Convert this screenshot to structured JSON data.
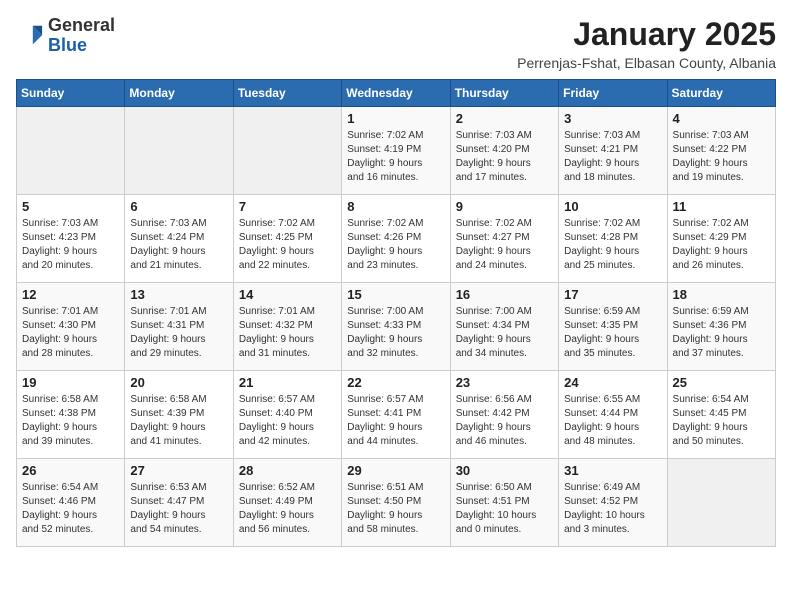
{
  "logo": {
    "general": "General",
    "blue": "Blue"
  },
  "title": {
    "month_year": "January 2025",
    "location": "Perrenjas-Fshat, Elbasan County, Albania"
  },
  "days_of_week": [
    "Sunday",
    "Monday",
    "Tuesday",
    "Wednesday",
    "Thursday",
    "Friday",
    "Saturday"
  ],
  "weeks": [
    [
      {
        "day": "",
        "info": ""
      },
      {
        "day": "",
        "info": ""
      },
      {
        "day": "",
        "info": ""
      },
      {
        "day": "1",
        "info": "Sunrise: 7:02 AM\nSunset: 4:19 PM\nDaylight: 9 hours\nand 16 minutes."
      },
      {
        "day": "2",
        "info": "Sunrise: 7:03 AM\nSunset: 4:20 PM\nDaylight: 9 hours\nand 17 minutes."
      },
      {
        "day": "3",
        "info": "Sunrise: 7:03 AM\nSunset: 4:21 PM\nDaylight: 9 hours\nand 18 minutes."
      },
      {
        "day": "4",
        "info": "Sunrise: 7:03 AM\nSunset: 4:22 PM\nDaylight: 9 hours\nand 19 minutes."
      }
    ],
    [
      {
        "day": "5",
        "info": "Sunrise: 7:03 AM\nSunset: 4:23 PM\nDaylight: 9 hours\nand 20 minutes."
      },
      {
        "day": "6",
        "info": "Sunrise: 7:03 AM\nSunset: 4:24 PM\nDaylight: 9 hours\nand 21 minutes."
      },
      {
        "day": "7",
        "info": "Sunrise: 7:02 AM\nSunset: 4:25 PM\nDaylight: 9 hours\nand 22 minutes."
      },
      {
        "day": "8",
        "info": "Sunrise: 7:02 AM\nSunset: 4:26 PM\nDaylight: 9 hours\nand 23 minutes."
      },
      {
        "day": "9",
        "info": "Sunrise: 7:02 AM\nSunset: 4:27 PM\nDaylight: 9 hours\nand 24 minutes."
      },
      {
        "day": "10",
        "info": "Sunrise: 7:02 AM\nSunset: 4:28 PM\nDaylight: 9 hours\nand 25 minutes."
      },
      {
        "day": "11",
        "info": "Sunrise: 7:02 AM\nSunset: 4:29 PM\nDaylight: 9 hours\nand 26 minutes."
      }
    ],
    [
      {
        "day": "12",
        "info": "Sunrise: 7:01 AM\nSunset: 4:30 PM\nDaylight: 9 hours\nand 28 minutes."
      },
      {
        "day": "13",
        "info": "Sunrise: 7:01 AM\nSunset: 4:31 PM\nDaylight: 9 hours\nand 29 minutes."
      },
      {
        "day": "14",
        "info": "Sunrise: 7:01 AM\nSunset: 4:32 PM\nDaylight: 9 hours\nand 31 minutes."
      },
      {
        "day": "15",
        "info": "Sunrise: 7:00 AM\nSunset: 4:33 PM\nDaylight: 9 hours\nand 32 minutes."
      },
      {
        "day": "16",
        "info": "Sunrise: 7:00 AM\nSunset: 4:34 PM\nDaylight: 9 hours\nand 34 minutes."
      },
      {
        "day": "17",
        "info": "Sunrise: 6:59 AM\nSunset: 4:35 PM\nDaylight: 9 hours\nand 35 minutes."
      },
      {
        "day": "18",
        "info": "Sunrise: 6:59 AM\nSunset: 4:36 PM\nDaylight: 9 hours\nand 37 minutes."
      }
    ],
    [
      {
        "day": "19",
        "info": "Sunrise: 6:58 AM\nSunset: 4:38 PM\nDaylight: 9 hours\nand 39 minutes."
      },
      {
        "day": "20",
        "info": "Sunrise: 6:58 AM\nSunset: 4:39 PM\nDaylight: 9 hours\nand 41 minutes."
      },
      {
        "day": "21",
        "info": "Sunrise: 6:57 AM\nSunset: 4:40 PM\nDaylight: 9 hours\nand 42 minutes."
      },
      {
        "day": "22",
        "info": "Sunrise: 6:57 AM\nSunset: 4:41 PM\nDaylight: 9 hours\nand 44 minutes."
      },
      {
        "day": "23",
        "info": "Sunrise: 6:56 AM\nSunset: 4:42 PM\nDaylight: 9 hours\nand 46 minutes."
      },
      {
        "day": "24",
        "info": "Sunrise: 6:55 AM\nSunset: 4:44 PM\nDaylight: 9 hours\nand 48 minutes."
      },
      {
        "day": "25",
        "info": "Sunrise: 6:54 AM\nSunset: 4:45 PM\nDaylight: 9 hours\nand 50 minutes."
      }
    ],
    [
      {
        "day": "26",
        "info": "Sunrise: 6:54 AM\nSunset: 4:46 PM\nDaylight: 9 hours\nand 52 minutes."
      },
      {
        "day": "27",
        "info": "Sunrise: 6:53 AM\nSunset: 4:47 PM\nDaylight: 9 hours\nand 54 minutes."
      },
      {
        "day": "28",
        "info": "Sunrise: 6:52 AM\nSunset: 4:49 PM\nDaylight: 9 hours\nand 56 minutes."
      },
      {
        "day": "29",
        "info": "Sunrise: 6:51 AM\nSunset: 4:50 PM\nDaylight: 9 hours\nand 58 minutes."
      },
      {
        "day": "30",
        "info": "Sunrise: 6:50 AM\nSunset: 4:51 PM\nDaylight: 10 hours\nand 0 minutes."
      },
      {
        "day": "31",
        "info": "Sunrise: 6:49 AM\nSunset: 4:52 PM\nDaylight: 10 hours\nand 3 minutes."
      },
      {
        "day": "",
        "info": ""
      }
    ]
  ]
}
